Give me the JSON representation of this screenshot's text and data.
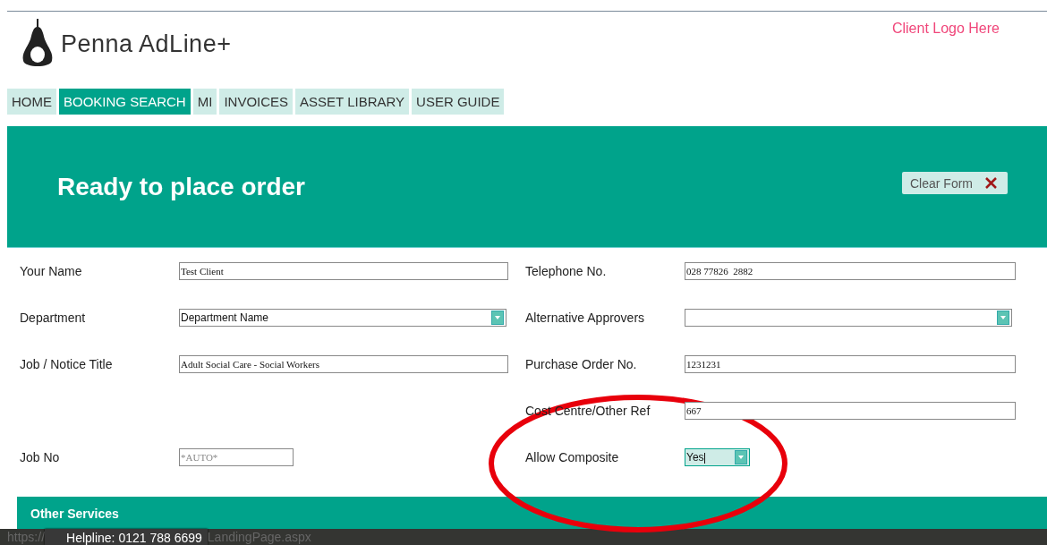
{
  "header": {
    "brand": "Penna AdLine+",
    "client_logo": "Client Logo Here"
  },
  "nav": [
    {
      "label": "HOME",
      "selected": false
    },
    {
      "label": "BOOKING SEARCH",
      "selected": true
    },
    {
      "label": "MI",
      "selected": false
    },
    {
      "label": "INVOICES",
      "selected": false
    },
    {
      "label": "ASSET LIBRARY",
      "selected": false
    },
    {
      "label": "USER GUIDE",
      "selected": false
    }
  ],
  "banner": {
    "title": "Ready to place order",
    "clear_button": "Clear Form"
  },
  "form": {
    "rows": [
      {
        "left": {
          "label": "Your Name",
          "kind": "text",
          "value": "Test Client"
        },
        "right": {
          "label": "Telephone No.",
          "kind": "text",
          "value": "028 77826  2882"
        }
      },
      {
        "left": {
          "label": "Department",
          "kind": "select",
          "value": "Department Name"
        },
        "right": {
          "label": "Alternative Approvers",
          "kind": "select"
        }
      },
      {
        "left": {
          "label": "Job / Notice Title",
          "kind": "text",
          "value": "Adult Social Care - Social Workers"
        },
        "right": {
          "label": "Purchase Order No.",
          "kind": "text",
          "value": "1231231"
        }
      },
      {
        "right": {
          "label": "Cost Centre/Other Ref",
          "kind": "text",
          "value": "667"
        }
      },
      {
        "left": {
          "label": "Job No",
          "kind": "short",
          "placeholder": "*AUTO*"
        },
        "right": {
          "label": "Allow Composite",
          "kind": "small-select",
          "value": "Yes"
        }
      }
    ]
  },
  "section": {
    "title": "Other Services"
  },
  "status_bar": {
    "url_start": "https://",
    "tooltip": "Helpline: 0121 788 6699",
    "url_end": "LandingPage.aspx"
  }
}
